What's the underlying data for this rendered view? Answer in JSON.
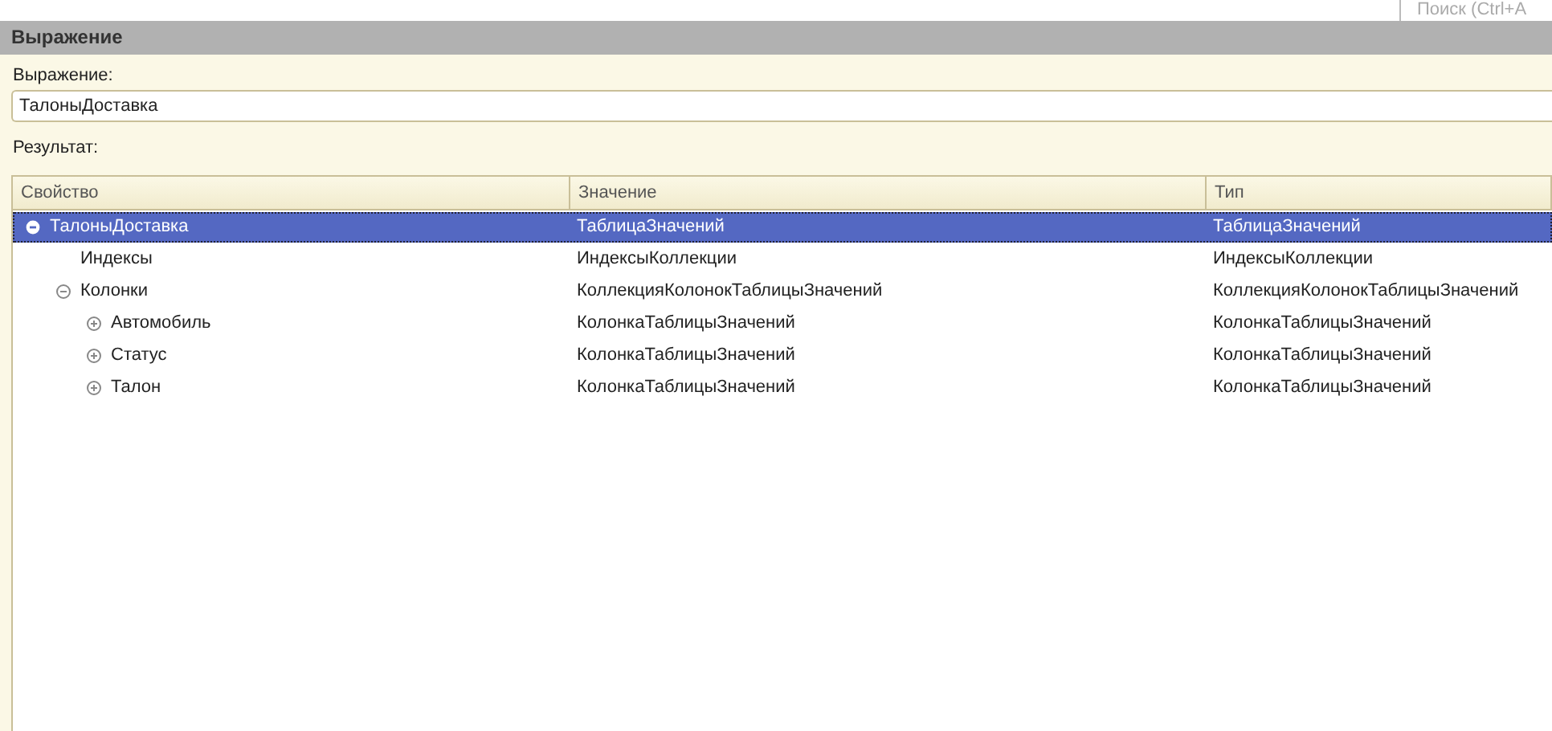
{
  "search": {
    "placeholder": "Поиск (Ctrl+A"
  },
  "window": {
    "title": "Выражение"
  },
  "expression": {
    "label": "Выражение:",
    "value": "ТалоныДоставка"
  },
  "result": {
    "label": "Результат:",
    "columns": [
      "Свойство",
      "Значение",
      "Тип"
    ],
    "rows": [
      {
        "property": "ТалоныДоставка",
        "value": "ТаблицаЗначений",
        "type": "ТаблицаЗначений",
        "selected": true,
        "expanded": true,
        "children": [
          {
            "property": "Индексы",
            "value": "ИндексыКоллекции",
            "type": "ИндексыКоллекции",
            "selected": false
          },
          {
            "property": "Колонки",
            "value": "КоллекцияКолонокТаблицыЗначений",
            "type": "КоллекцияКолонокТаблицыЗначений",
            "selected": false,
            "expanded": true,
            "children": [
              {
                "property": "Автомобиль",
                "value": "КолонкаТаблицыЗначений",
                "type": "КолонкаТаблицыЗначений",
                "selected": false,
                "expanded": false
              },
              {
                "property": "Статус",
                "value": "КолонкаТаблицыЗначений",
                "type": "КолонкаТаблицыЗначений",
                "selected": false,
                "expanded": false
              },
              {
                "property": "Талон",
                "value": "КолонкаТаблицыЗначений",
                "type": "КолонкаТаблицыЗначений",
                "selected": false,
                "expanded": false
              }
            ]
          }
        ]
      }
    ]
  }
}
